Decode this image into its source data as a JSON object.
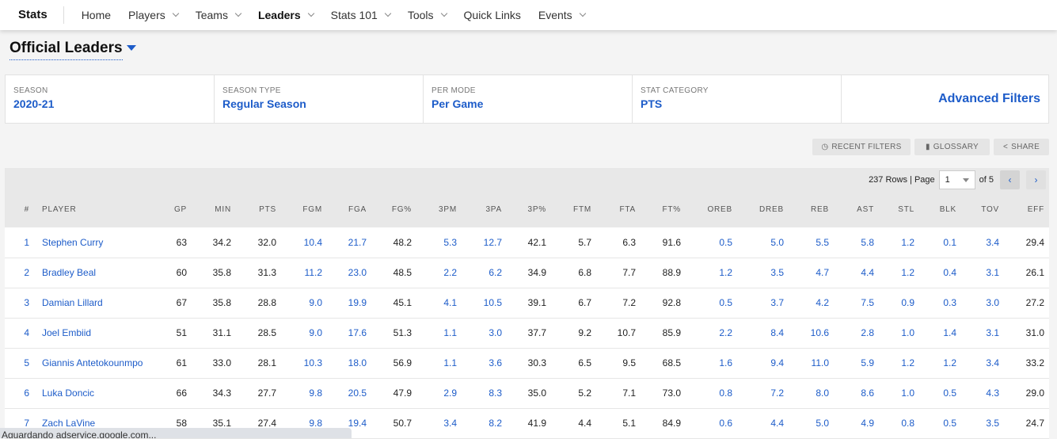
{
  "nav": {
    "brand": "Stats",
    "items": [
      {
        "label": "Home",
        "dropdown": false
      },
      {
        "label": "Players",
        "dropdown": true
      },
      {
        "label": "Teams",
        "dropdown": true
      },
      {
        "label": "Leaders",
        "dropdown": true,
        "active": true
      },
      {
        "label": "Stats 101",
        "dropdown": true
      },
      {
        "label": "Tools",
        "dropdown": true
      },
      {
        "label": "Quick Links",
        "dropdown": false
      },
      {
        "label": "Events",
        "dropdown": true
      }
    ]
  },
  "page": {
    "title": "Official Leaders"
  },
  "filters": [
    {
      "label": "SEASON",
      "value": "2020-21"
    },
    {
      "label": "SEASON TYPE",
      "value": "Regular Season"
    },
    {
      "label": "PER MODE",
      "value": "Per Game"
    },
    {
      "label": "STAT CATEGORY",
      "value": "PTS"
    }
  ],
  "advanced_filters": "Advanced Filters",
  "tools": {
    "recent": "RECENT FILTERS",
    "glossary": "GLOSSARY",
    "share": "SHARE"
  },
  "pager": {
    "rows": "237 Rows | Page",
    "page": "1",
    "of": "of 5"
  },
  "accent": "#1d5cc9",
  "table": {
    "columns": [
      "#",
      "PLAYER",
      "GP",
      "MIN",
      "PTS",
      "FGM",
      "FGA",
      "FG%",
      "3PM",
      "3PA",
      "3P%",
      "FTM",
      "FTA",
      "FT%",
      "OREB",
      "DREB",
      "REB",
      "AST",
      "STL",
      "BLK",
      "TOV",
      "EFF"
    ],
    "rows": [
      [
        "1",
        "Stephen Curry",
        "63",
        "34.2",
        "32.0",
        "10.4",
        "21.7",
        "48.2",
        "5.3",
        "12.7",
        "42.1",
        "5.7",
        "6.3",
        "91.6",
        "0.5",
        "5.0",
        "5.5",
        "5.8",
        "1.2",
        "0.1",
        "3.4",
        "29.4"
      ],
      [
        "2",
        "Bradley Beal",
        "60",
        "35.8",
        "31.3",
        "11.2",
        "23.0",
        "48.5",
        "2.2",
        "6.2",
        "34.9",
        "6.8",
        "7.7",
        "88.9",
        "1.2",
        "3.5",
        "4.7",
        "4.4",
        "1.2",
        "0.4",
        "3.1",
        "26.1"
      ],
      [
        "3",
        "Damian Lillard",
        "67",
        "35.8",
        "28.8",
        "9.0",
        "19.9",
        "45.1",
        "4.1",
        "10.5",
        "39.1",
        "6.7",
        "7.2",
        "92.8",
        "0.5",
        "3.7",
        "4.2",
        "7.5",
        "0.9",
        "0.3",
        "3.0",
        "27.2"
      ],
      [
        "4",
        "Joel Embiid",
        "51",
        "31.1",
        "28.5",
        "9.0",
        "17.6",
        "51.3",
        "1.1",
        "3.0",
        "37.7",
        "9.2",
        "10.7",
        "85.9",
        "2.2",
        "8.4",
        "10.6",
        "2.8",
        "1.0",
        "1.4",
        "3.1",
        "31.0"
      ],
      [
        "5",
        "Giannis Antetokounmpo",
        "61",
        "33.0",
        "28.1",
        "10.3",
        "18.0",
        "56.9",
        "1.1",
        "3.6",
        "30.3",
        "6.5",
        "9.5",
        "68.5",
        "1.6",
        "9.4",
        "11.0",
        "5.9",
        "1.2",
        "1.2",
        "3.4",
        "33.2"
      ],
      [
        "6",
        "Luka Doncic",
        "66",
        "34.3",
        "27.7",
        "9.8",
        "20.5",
        "47.9",
        "2.9",
        "8.3",
        "35.0",
        "5.2",
        "7.1",
        "73.0",
        "0.8",
        "7.2",
        "8.0",
        "8.6",
        "1.0",
        "0.5",
        "4.3",
        "29.0"
      ],
      [
        "7",
        "Zach LaVine",
        "58",
        "35.1",
        "27.4",
        "9.8",
        "19.4",
        "50.7",
        "3.4",
        "8.2",
        "41.9",
        "4.4",
        "5.1",
        "84.9",
        "0.6",
        "4.4",
        "5.0",
        "4.9",
        "0.8",
        "0.5",
        "3.5",
        "24.7"
      ]
    ]
  },
  "status": "Aguardando adservice.google.com..."
}
